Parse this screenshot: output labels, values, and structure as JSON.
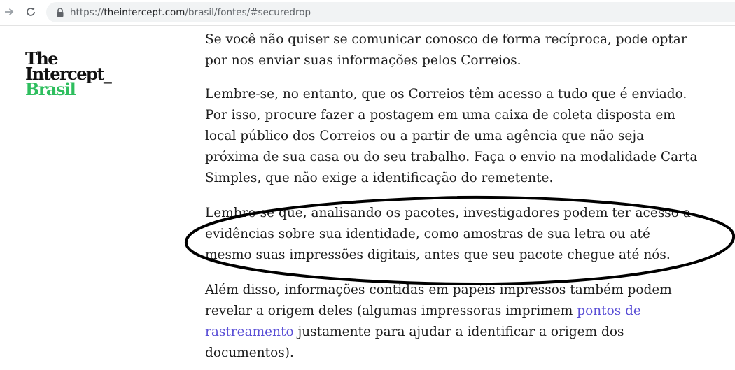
{
  "browser": {
    "url_prefix": "https://",
    "url_host": "theintercept.com",
    "url_path": "/brasil/fontes/#securedrop"
  },
  "logo": {
    "line1": "The",
    "line2": "Intercept_",
    "line3": "Brasil",
    "accent_color": "#2ebe5e"
  },
  "article": {
    "p1": [
      "Se você não quiser se comunicar conosco de forma recíproca, pode optar",
      "por nos enviar suas informações pelos Correios."
    ],
    "p2": [
      "Lembre-se, no entanto, que os Correios têm acesso a tudo que é enviado.",
      "Por isso, procure fazer a postagem em uma caixa de coleta disposta em",
      "local público dos Correios ou a partir de uma agência que não seja",
      "próxima de sua casa ou do seu trabalho. Faça o envio na modalidade Carta",
      "Simples, que não exige a identificação do remetente."
    ],
    "p3": [
      "Lembre-se que, analisando os pacotes, investigadores podem ter acesso a",
      "evidências sobre sua identidade, como amostras de sua letra ou até",
      "mesmo suas impressões digitais, antes que seu pacote chegue até nós."
    ],
    "p4": {
      "l1": "Além disso, informações contidas em papéis impressos também podem",
      "l2_text": "revelar a origem deles (algumas impressoras imprimem ",
      "l2_link": "pontos de",
      "l3_link": "rastreamento",
      "l3_text": " justamente para ajudar a identificar a origem dos",
      "l4": "documentos)."
    },
    "link_color": "#5a4fd6"
  }
}
